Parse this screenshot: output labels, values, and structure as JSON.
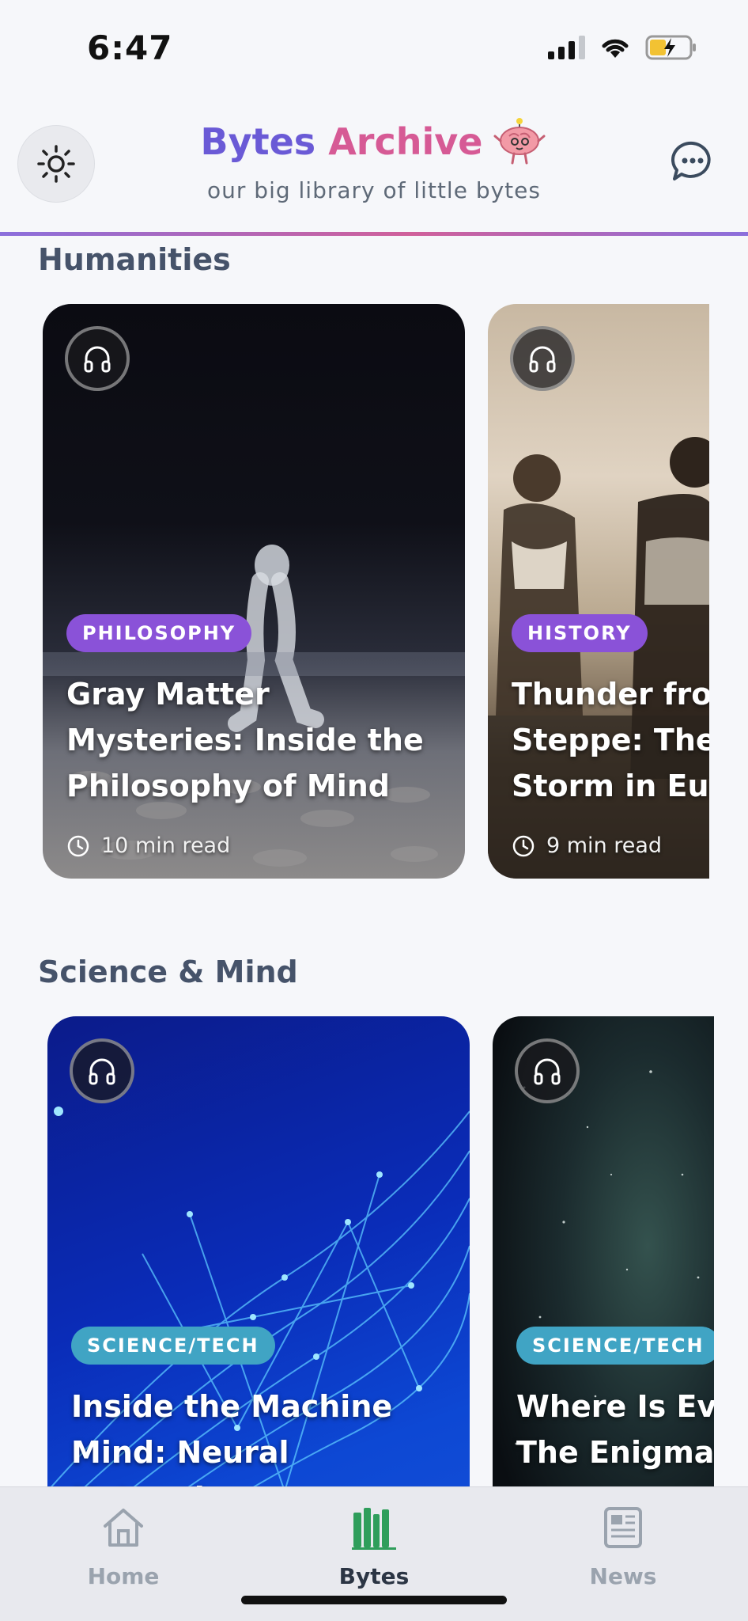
{
  "status": {
    "time": "6:47"
  },
  "header": {
    "title_word1": "Bytes",
    "title_word2": "Archive",
    "subtitle": "our big library of little bytes",
    "mascot_icon": "brain-mascot-icon",
    "accent_purple": "#6a5ad6",
    "accent_pink": "#d65a95"
  },
  "sections": [
    {
      "title": "Humanities",
      "cards": [
        {
          "category": "PHILOSOPHY",
          "title": "Gray Matter Mysteries: Inside the Philosophy of Mind",
          "read_time": "10 min read",
          "pill_color": "#8a52d8"
        },
        {
          "category": "HISTORY",
          "title_lines": [
            "Thunder fro",
            "Steppe: The",
            "Storm in Eur"
          ],
          "read_time": "9 min read",
          "pill_color": "#8a52d8"
        }
      ]
    },
    {
      "title": "Science & Mind",
      "cards": [
        {
          "category": "SCIENCE/TECH",
          "title": "Inside the Machine Mind: Neural Networks",
          "pill_color": "#40a4c4"
        },
        {
          "category": "SCIENCE/TECH",
          "title_lines": [
            "Where Is Eve",
            "The Enigma"
          ],
          "pill_color": "#40a4c4"
        }
      ]
    }
  ],
  "tabbar": {
    "items": [
      {
        "label": "Home",
        "icon": "home-icon"
      },
      {
        "label": "Bytes",
        "icon": "bookshelf-icon",
        "active": true
      },
      {
        "label": "News",
        "icon": "newspaper-icon"
      }
    ],
    "active_color": "#2f9e5b"
  }
}
